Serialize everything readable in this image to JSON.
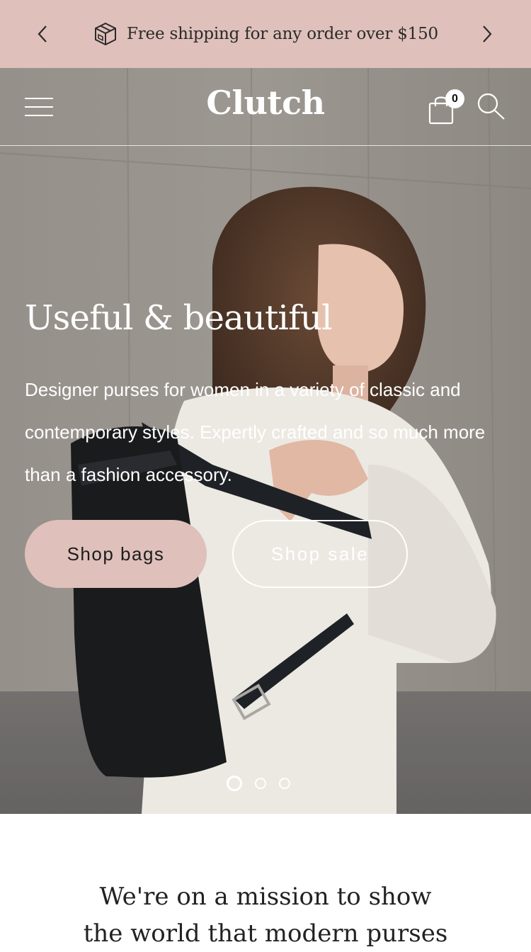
{
  "announcement": {
    "prev_icon": "chevron-left-icon",
    "next_icon": "chevron-right-icon",
    "box_icon": "package-box-icon",
    "text": "Free shipping for any order over $150",
    "background": "#dfc0bb"
  },
  "header": {
    "logo": "Clutch",
    "menu_icon": "hamburger-menu-icon",
    "cart_icon": "shopping-bag-icon",
    "cart_count": "0",
    "search_icon": "search-icon"
  },
  "hero": {
    "title": "Useful & beautiful",
    "body": "Designer purses for women in a variety of classic and contemporary styles. Expertly crafted and so much more than a fashion accessory.",
    "primary_button": "Shop bags",
    "secondary_button": "Shop sale",
    "slides_total": 3,
    "active_slide": 1
  },
  "mission": {
    "line1": "We're on a mission to show",
    "line2": "the world that modern purses"
  },
  "colors": {
    "accent": "#dfc0bb",
    "text_dark": "#222222"
  }
}
